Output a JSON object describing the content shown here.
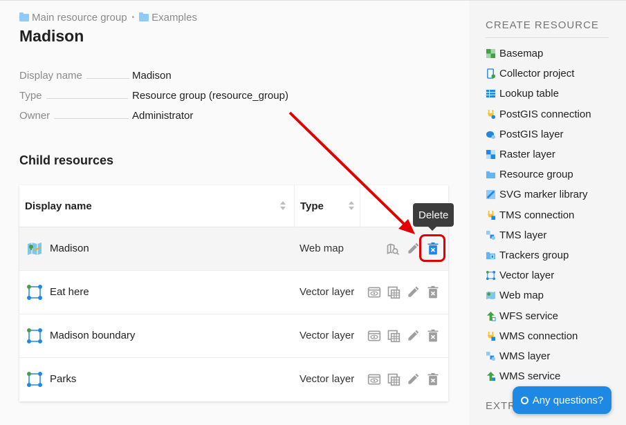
{
  "breadcrumb": {
    "items": [
      "Main resource group",
      "Examples"
    ],
    "separator": "•"
  },
  "page": {
    "title": "Madison"
  },
  "properties": [
    {
      "label": "Display name",
      "value": "Madison"
    },
    {
      "label": "Type",
      "value": "Resource group (resource_group)"
    },
    {
      "label": "Owner",
      "value": "Administrator"
    }
  ],
  "child_resources": {
    "title": "Child resources",
    "columns": [
      "Display name",
      "Type"
    ],
    "rows": [
      {
        "name": "Madison",
        "type": "Web map",
        "icon": "web-map-icon"
      },
      {
        "name": "Eat here",
        "type": "Vector layer",
        "icon": "vector-layer-icon"
      },
      {
        "name": "Madison boundary",
        "type": "Vector layer",
        "icon": "vector-layer-icon"
      },
      {
        "name": "Parks",
        "type": "Vector layer",
        "icon": "vector-layer-icon"
      }
    ]
  },
  "tooltip": {
    "text": "Delete"
  },
  "sidebar": {
    "title": "CREATE RESOURCE",
    "items": [
      {
        "label": "Basemap",
        "icon": "basemap-icon"
      },
      {
        "label": "Collector project",
        "icon": "collector-project-icon"
      },
      {
        "label": "Lookup table",
        "icon": "lookup-table-icon"
      },
      {
        "label": "PostGIS connection",
        "icon": "postgis-connection-icon"
      },
      {
        "label": "PostGIS layer",
        "icon": "postgis-layer-icon"
      },
      {
        "label": "Raster layer",
        "icon": "raster-layer-icon"
      },
      {
        "label": "Resource group",
        "icon": "resource-group-icon"
      },
      {
        "label": "SVG marker library",
        "icon": "svg-marker-library-icon"
      },
      {
        "label": "TMS connection",
        "icon": "tms-connection-icon"
      },
      {
        "label": "TMS layer",
        "icon": "tms-layer-icon"
      },
      {
        "label": "Trackers group",
        "icon": "trackers-group-icon"
      },
      {
        "label": "Vector layer",
        "icon": "vector-layer-icon"
      },
      {
        "label": "Web map",
        "icon": "web-map-icon"
      },
      {
        "label": "WFS service",
        "icon": "wfs-service-icon"
      },
      {
        "label": "WMS connection",
        "icon": "wms-connection-icon"
      },
      {
        "label": "WMS layer",
        "icon": "wms-layer-icon"
      },
      {
        "label": "WMS service",
        "icon": "wms-service-icon"
      }
    ],
    "second_title": "EXTR"
  },
  "chat": {
    "label": "Any questions?"
  },
  "colors": {
    "accent": "#1e88e5",
    "highlight": "#e00000",
    "action_icon": "#9e9e9e"
  }
}
